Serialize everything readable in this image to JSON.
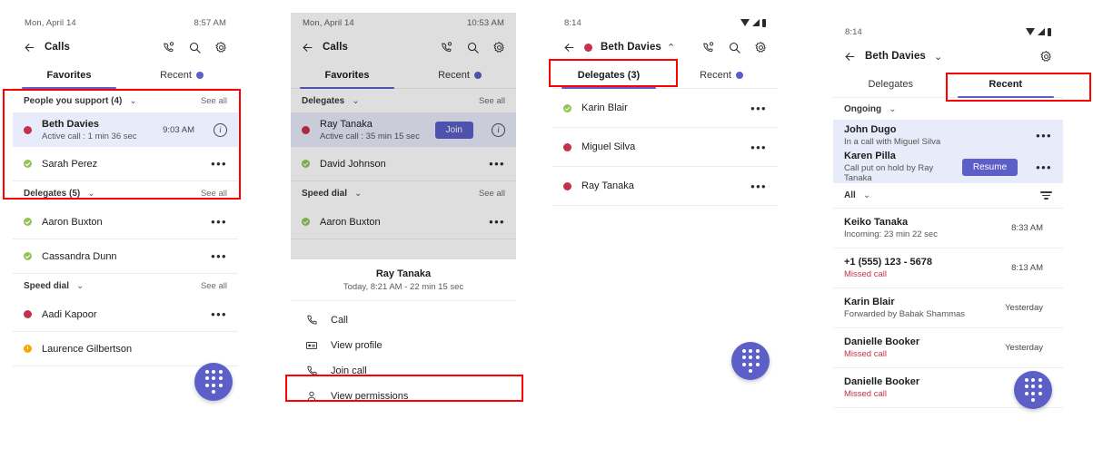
{
  "phone1": {
    "status": {
      "time_label": "Mon, April 14",
      "clock": "8:57 AM"
    },
    "appbar": {
      "title": "Calls",
      "back_icon": "back-arrow-icon",
      "call_icon": "call-person-icon",
      "search_icon": "search-icon",
      "settings_icon": "gear-icon"
    },
    "tabs": [
      {
        "label": "Favorites",
        "active": true
      },
      {
        "label": "Recent",
        "active": false,
        "badge": true
      }
    ],
    "sections": [
      {
        "label": "People you support (4)",
        "see_all": "See all",
        "rows": [
          {
            "name": "Beth Davies",
            "sub": "Active call : 1 min 36 sec",
            "time": "9:03 AM",
            "presence": "busy",
            "highlight": true,
            "trailing": "info"
          },
          {
            "name": "Sarah Perez",
            "sub": "",
            "time": "",
            "presence": "available",
            "trailing": "dots"
          }
        ]
      },
      {
        "label": "Delegates (5)",
        "see_all": "See all",
        "rows": [
          {
            "name": "Aaron Buxton",
            "sub": "",
            "time": "",
            "presence": "available",
            "trailing": "dots"
          },
          {
            "name": "Cassandra Dunn",
            "sub": "",
            "time": "",
            "presence": "available",
            "trailing": "dots"
          }
        ]
      },
      {
        "label": "Speed dial",
        "see_all": "See all",
        "rows": [
          {
            "name": "Aadi Kapoor",
            "sub": "",
            "time": "",
            "presence": "busy",
            "trailing": "dots"
          },
          {
            "name": "Laurence Gilbertson",
            "sub": "",
            "time": "",
            "presence": "away",
            "trailing": "none"
          }
        ]
      }
    ],
    "fab": "dialpad-fab"
  },
  "phone2": {
    "status": {
      "time_label": "Mon, April 14",
      "clock": "10:53 AM"
    },
    "appbar": {
      "title": "Calls"
    },
    "tabs": [
      {
        "label": "Favorites",
        "active": true
      },
      {
        "label": "Recent",
        "active": false,
        "badge": true
      }
    ],
    "sections": [
      {
        "label": "Delegates",
        "see_all": "See all",
        "rows": [
          {
            "name": "Ray Tanaka",
            "sub": "Active call : 35 min 15 sec",
            "presence": "busy",
            "highlight": true,
            "button": "Join",
            "trailing": "info"
          },
          {
            "name": "David Johnson",
            "sub": "",
            "presence": "available",
            "trailing": "dots"
          }
        ]
      },
      {
        "label": "Speed dial",
        "see_all": "See all",
        "rows": [
          {
            "name": "Aaron Buxton",
            "sub": "",
            "presence": "available",
            "trailing": "dots"
          }
        ]
      }
    ],
    "sheet": {
      "title": "Ray Tanaka",
      "subtitle": "Today, 8:21 AM - 22 min 15 sec",
      "items": [
        {
          "label": "Call",
          "icon": "phone-icon"
        },
        {
          "label": "View profile",
          "icon": "contact-card-icon"
        },
        {
          "label": "Join call",
          "icon": "phone-icon"
        },
        {
          "label": "View permissions",
          "icon": "person-icon",
          "highlighted": true
        }
      ]
    }
  },
  "phone3": {
    "status": {
      "clock": "8:14"
    },
    "appbar": {
      "title": "Beth Davies",
      "presence": "busy",
      "chevron": "chevron-up-icon"
    },
    "tabs": [
      {
        "label": "Delegates (3)",
        "active": true,
        "highlighted": true
      },
      {
        "label": "Recent",
        "active": false,
        "badge": true
      }
    ],
    "rows": [
      {
        "name": "Karin Blair",
        "presence": "available",
        "trailing": "dots"
      },
      {
        "name": "Miguel Silva",
        "presence": "busy",
        "trailing": "dots"
      },
      {
        "name": "Ray Tanaka",
        "presence": "busy",
        "trailing": "dots"
      }
    ],
    "fab": "dialpad-fab"
  },
  "phone4": {
    "status": {
      "clock": "8:14"
    },
    "appbar": {
      "title": "Beth Davies",
      "chevron": "chevron-down-icon",
      "settings_icon": "gear-icon"
    },
    "tabs": [
      {
        "label": "Delegates",
        "active": false
      },
      {
        "label": "Recent",
        "active": true,
        "highlighted": true
      }
    ],
    "ongoing": {
      "label": "Ongoing",
      "rows": [
        {
          "name": "John Dugo",
          "sub": "In a call with Miguel Silva",
          "trailing": "dots"
        },
        {
          "name": "Karen Pilla",
          "sub": "Call put on hold by Ray Tanaka",
          "button": "Resume",
          "trailing": "dots"
        }
      ]
    },
    "filter": {
      "label": "All",
      "chevron": "chevron-down-icon",
      "filter_icon": "filter-icon"
    },
    "history": [
      {
        "name": "Keiko Tanaka",
        "sub": "Incoming: 23 min 22 sec",
        "sub_missed": false,
        "time": "8:33 AM"
      },
      {
        "name": "+1 (555) 123 - 5678",
        "sub": "Missed call",
        "sub_missed": true,
        "time": "8:13 AM"
      },
      {
        "name": "Karin Blair",
        "sub": "Forwarded by Babak Shammas",
        "sub_missed": false,
        "time": "Yesterday"
      },
      {
        "name": "Danielle Booker",
        "sub": "Missed call",
        "sub_missed": true,
        "time": "Yesterday"
      },
      {
        "name": "Danielle Booker",
        "sub": "Missed call",
        "sub_missed": true,
        "time": ""
      }
    ],
    "fab": "dialpad-fab"
  },
  "colors": {
    "accent": "#5b5fc7",
    "busy": "#c4314b",
    "available": "#92c353",
    "away": "#f8a800",
    "missed": "#c4314b",
    "highlight_row": "#e8ebfa",
    "annotation": "#ff0000"
  }
}
